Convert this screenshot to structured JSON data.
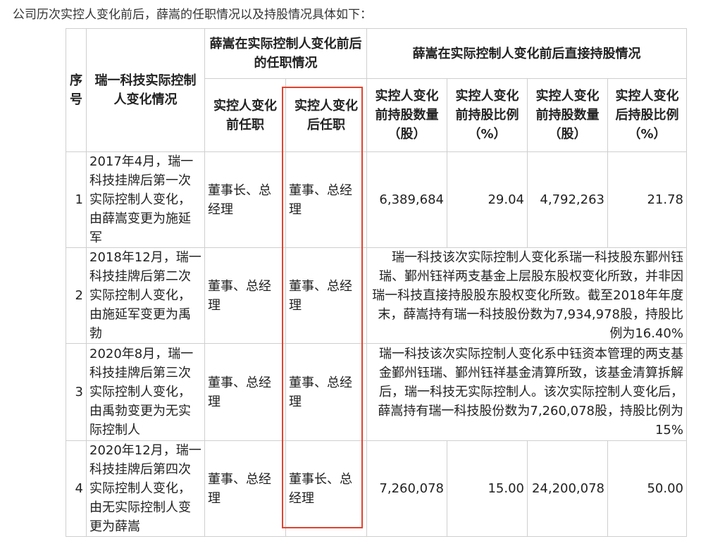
{
  "intro": "公司历次实控人变化前后，薛嵩的任职情况以及持股情况具体如下：",
  "table": {
    "headers": {
      "seq": "序号",
      "change": "瑞一科技实际控制人变化情况",
      "position_group": "薛嵩在实际控制人变化前后的任职情况",
      "holding_group": "薛嵩在实际控制人变化前后直接持股情况",
      "pos_before": "实控人变化前任职",
      "pos_after": "实控人变化后任职",
      "qty_before": "实控人变化前持股数量（股）",
      "ratio_before": "实控人变化前持股比例（%）",
      "qty_after": "实控人变化前持股数量（股）",
      "ratio_after": "实控人变化后持股比例（%）"
    },
    "rows": [
      {
        "seq": "1",
        "change": "2017年4月，瑞一科技挂牌后第一次实际控制人变化，由薛嵩变更为施延军",
        "pos_before": "董事长、总经理",
        "pos_after": "董事、总经理",
        "qty_before": "6,389,684",
        "ratio_before": "29.04",
        "qty_after": "4,792,263",
        "ratio_after": "21.78"
      },
      {
        "seq": "2",
        "change": "2018年12月，瑞一科技挂牌后第二次实际控制人变化，由施延军变更为禹勃",
        "pos_before": "董事、总经理",
        "pos_after": "董事、总经理",
        "note": "瑞一科技该次实际控制人变化系瑞一科技股东鄞州钰瑞、鄞州钰祥两支基金上层股东股权变化所致，并非因瑞一科技直接持股股东股权变化所致。截至2018年年度末，薛嵩持有瑞一科技股份数为7,934,978股，持股比例为16.40%"
      },
      {
        "seq": "3",
        "change": "2020年8月，瑞一科技挂牌后第三次实际控制人变化，由禹勃变更为无实际控制人",
        "pos_before": "董事、总经理",
        "pos_after": "董事、总经理",
        "note": "瑞一科技该次实际控制人变化系中钰资本管理的两支基金鄞州钰瑞、鄞州钰祥基金清算所致，该基金清算拆解后，瑞一科技无实际控制人。该次实际控制人变化后，薛嵩持有瑞一科技股份数为7,260,078股，持股比例为15%"
      },
      {
        "seq": "4",
        "change": "2020年12月，瑞一科技挂牌后第四次实际控制人变化，由无实际控制人变更为薛嵩",
        "pos_before": "董事、总经理",
        "pos_after": "董事长、总经理",
        "qty_before": "7,260,078",
        "ratio_before": "15.00",
        "qty_after": "24,200,078",
        "ratio_after": "50.00"
      }
    ]
  },
  "highlight_color": "#e2432f"
}
